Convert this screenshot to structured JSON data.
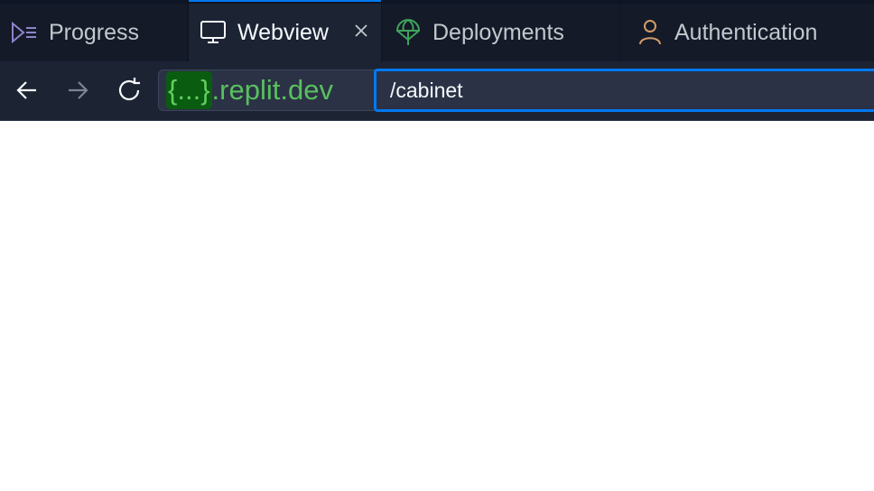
{
  "tabs": [
    {
      "label": "Progress",
      "icon": "progress-icon",
      "active": false
    },
    {
      "label": "Webview",
      "icon": "monitor-icon",
      "active": true
    },
    {
      "label": "Deployments",
      "icon": "deployments-icon",
      "active": false
    },
    {
      "label": "Authentication",
      "icon": "person-icon",
      "active": false
    }
  ],
  "address": {
    "subdomain": "{...}",
    "domain": ".replit.dev",
    "path": "/cabinet"
  },
  "colors": {
    "background": "#1c2333",
    "accent": "#0079f2",
    "domain_green": "#58c05e",
    "auth_orange": "#d29b6a"
  }
}
